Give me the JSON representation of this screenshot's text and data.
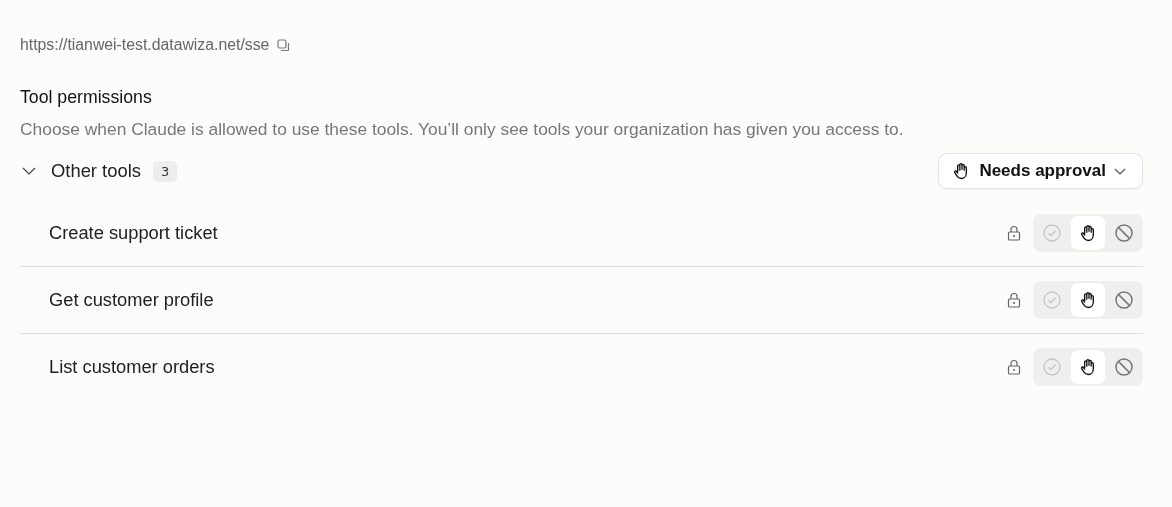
{
  "server_url": "https://tianwei-test.datawiza.net/sse",
  "section": {
    "title": "Tool permissions",
    "description": "Choose when Claude is allowed to use these tools. You’ll only see tools your organization has given you access to."
  },
  "group": {
    "label": "Other tools",
    "count": "3",
    "expanded": true,
    "permission": "Needs approval",
    "tools": [
      {
        "name": "Create support ticket",
        "locked": true,
        "options": [
          {
            "kind": "allow",
            "selected": false,
            "disabled": true
          },
          {
            "kind": "approve",
            "selected": true,
            "disabled": false
          },
          {
            "kind": "block",
            "selected": false,
            "disabled": false
          }
        ]
      },
      {
        "name": "Get customer profile",
        "locked": true,
        "options": [
          {
            "kind": "allow",
            "selected": false,
            "disabled": true
          },
          {
            "kind": "approve",
            "selected": true,
            "disabled": false
          },
          {
            "kind": "block",
            "selected": false,
            "disabled": false
          }
        ]
      },
      {
        "name": "List customer orders",
        "locked": true,
        "options": [
          {
            "kind": "allow",
            "selected": false,
            "disabled": true
          },
          {
            "kind": "approve",
            "selected": true,
            "disabled": false
          },
          {
            "kind": "block",
            "selected": false,
            "disabled": false
          }
        ]
      }
    ]
  }
}
